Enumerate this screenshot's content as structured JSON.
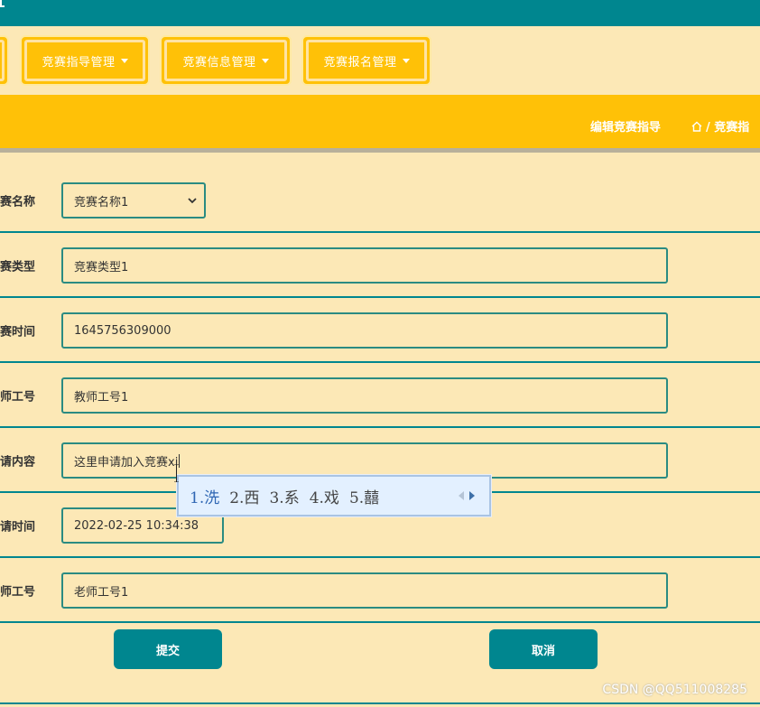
{
  "header": {
    "bg_color": "#00868f"
  },
  "nav": {
    "menus": [
      {
        "label": "竞赛指导管理"
      },
      {
        "label": "竞赛信息管理"
      },
      {
        "label": "竞赛报名管理"
      }
    ]
  },
  "breadcrumb": {
    "title": "编辑竞赛指导",
    "path": "/ 竞赛指"
  },
  "form": {
    "fields": [
      {
        "label": "赛名称",
        "value": "竞赛名称1"
      },
      {
        "label": "赛类型",
        "value": "竞赛类型1"
      },
      {
        "label": "赛时间",
        "value": "1645756309000"
      },
      {
        "label": "师工号",
        "value": "教师工号1"
      },
      {
        "label": "请内容",
        "value": "这里申请加入竞赛xi"
      },
      {
        "label": "请时间",
        "value": "2022-02-25 10:34:38"
      },
      {
        "label": "师工号",
        "value": "老师工号1"
      }
    ],
    "submit_label": "提交",
    "cancel_label": "取消"
  },
  "ime": {
    "candidates": [
      "1.洗",
      "2.西",
      "3.系",
      "4.戏",
      "5.囍"
    ]
  },
  "watermark": "CSDN @QQ511008285",
  "colors": {
    "teal": "#00868f",
    "gold": "#ffc107",
    "cream": "#fce8b6"
  }
}
